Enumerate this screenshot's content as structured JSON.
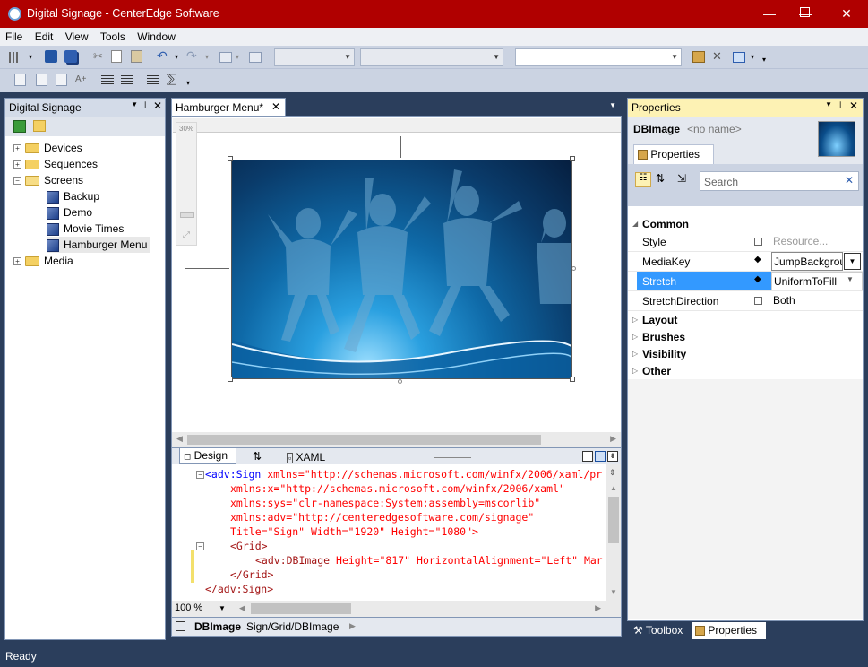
{
  "window": {
    "title": "Digital Signage - CenterEdge Software",
    "min": "—",
    "max": "☐",
    "close": "✕"
  },
  "menu": [
    "File",
    "Edit",
    "View",
    "Tools",
    "Window"
  ],
  "left_panel": {
    "title": "Digital Signage",
    "tree": [
      {
        "label": "Devices"
      },
      {
        "label": "Sequences"
      },
      {
        "label": "Screens"
      },
      {
        "label": "Backup"
      },
      {
        "label": "Demo"
      },
      {
        "label": "Movie Times"
      },
      {
        "label": "Hamburger Menu"
      },
      {
        "label": "Media"
      }
    ]
  },
  "document": {
    "tab": "Hamburger Menu*",
    "zoom_ruler": "30%",
    "bottom_tabs": {
      "design": "Design",
      "swap": "⇅",
      "xaml": "XAML"
    },
    "xaml_lines": [
      {
        "tag": "<adv:Sign",
        "rest": " xmlns=\"http://schemas.microsoft.com/winfx/2006/xaml/pr"
      },
      {
        "tag": "",
        "rest": "xmlns:x=\"http://schemas.microsoft.com/winfx/2006/xaml\""
      },
      {
        "tag": "",
        "rest": "xmlns:sys=\"clr-namespace:System;assembly=mscorlib\""
      },
      {
        "tag": "",
        "rest": "xmlns:adv=\"http://centeredgesoftware.com/signage\""
      },
      {
        "tag": "",
        "rest": "Title=\"Sign\" Width=\"1920\" Height=\"1080\">"
      },
      {
        "tag": "<Grid>",
        "rest": ""
      },
      {
        "tag": "<adv:DBImage",
        "rest": " Height=\"817\" HorizontalAlignment=\"Left\" Mar"
      },
      {
        "tag": "</Grid>",
        "rest": ""
      },
      {
        "tag": "</adv:Sign>",
        "rest": ""
      }
    ],
    "zoom": "100 %",
    "breadcrumb_bold": "DBImage",
    "breadcrumb_path": "Sign/Grid/DBImage"
  },
  "properties": {
    "title": "Properties",
    "object_type": "DBImage",
    "object_name": "<no name>",
    "tab": "Properties",
    "search_placeholder": "Search",
    "categories": {
      "common": "Common",
      "layout": "Layout",
      "brushes": "Brushes",
      "visibility": "Visibility",
      "other": "Other"
    },
    "rows": [
      {
        "name": "Style",
        "value": "Resource..."
      },
      {
        "name": "MediaKey",
        "value": "JumpBackground"
      },
      {
        "name": "Stretch",
        "value": "UniformToFill"
      },
      {
        "name": "StretchDirection",
        "value": "Both"
      }
    ],
    "bottom_tabs": {
      "toolbox": "Toolbox",
      "properties": "Properties"
    }
  },
  "status": {
    "text": "Ready"
  },
  "colors": {
    "titlebar": "#b00000",
    "chrome": "#2b3e5c",
    "selection": "#3399ff",
    "panel_header_active": "#fdf2b4"
  }
}
